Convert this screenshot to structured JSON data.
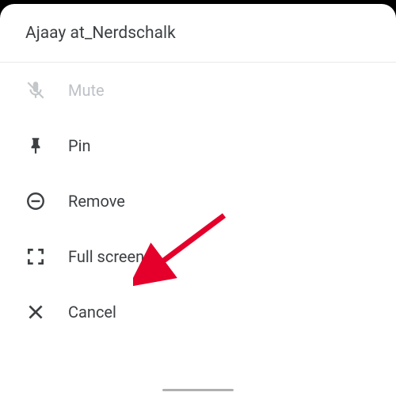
{
  "header": {
    "title": "Ajaay at_Nerdschalk"
  },
  "menu": {
    "mute": {
      "label": "Mute"
    },
    "pin": {
      "label": "Pin"
    },
    "remove": {
      "label": "Remove"
    },
    "fullscreen": {
      "label": "Full screen"
    },
    "cancel": {
      "label": "Cancel"
    }
  }
}
